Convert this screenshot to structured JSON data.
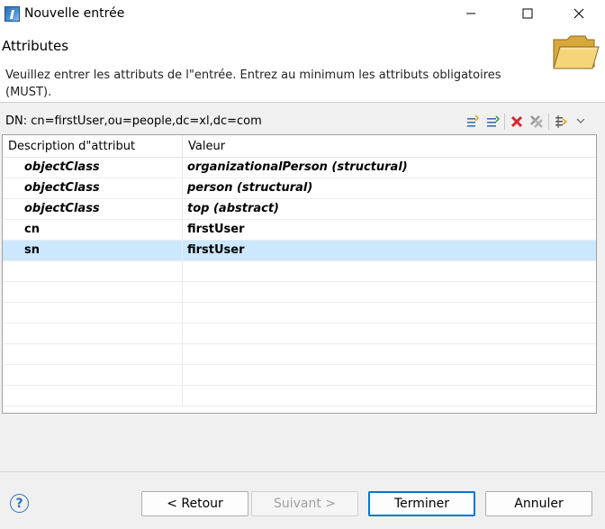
{
  "window": {
    "title": "Nouvelle entrée"
  },
  "header": {
    "title": "Attributes",
    "description": "Veuillez entrer les attributs de l\"entrée. Entrez au minimum les attributs obligatoires (MUST)."
  },
  "dn": {
    "label": "DN: cn=firstUser,ou=people,dc=xl,dc=com"
  },
  "toolbar": {
    "icons": [
      "new-attribute-icon",
      "new-value-icon",
      "delete-icon",
      "delete-all-icon",
      "sort-icon",
      "menu-dropdown-icon"
    ]
  },
  "table": {
    "columns": [
      "Description d\"attribut",
      "Valeur"
    ],
    "rows": [
      {
        "attr": "objectClass",
        "value": "organizationalPerson (structural)"
      },
      {
        "attr": "objectClass",
        "value": "person (structural)"
      },
      {
        "attr": "objectClass",
        "value": "top (abstract)"
      },
      {
        "attr": "cn",
        "value": "firstUser"
      },
      {
        "attr": "sn",
        "value": "firstUser"
      }
    ],
    "selected_row": 4
  },
  "buttons": {
    "back": "< Retour",
    "next": "Suivant >",
    "finish": "Terminer",
    "cancel": "Annuler",
    "help": "?"
  },
  "colors": {
    "selection": "#cce8ff",
    "accent": "#0078d7",
    "delete": "#d9262c"
  }
}
